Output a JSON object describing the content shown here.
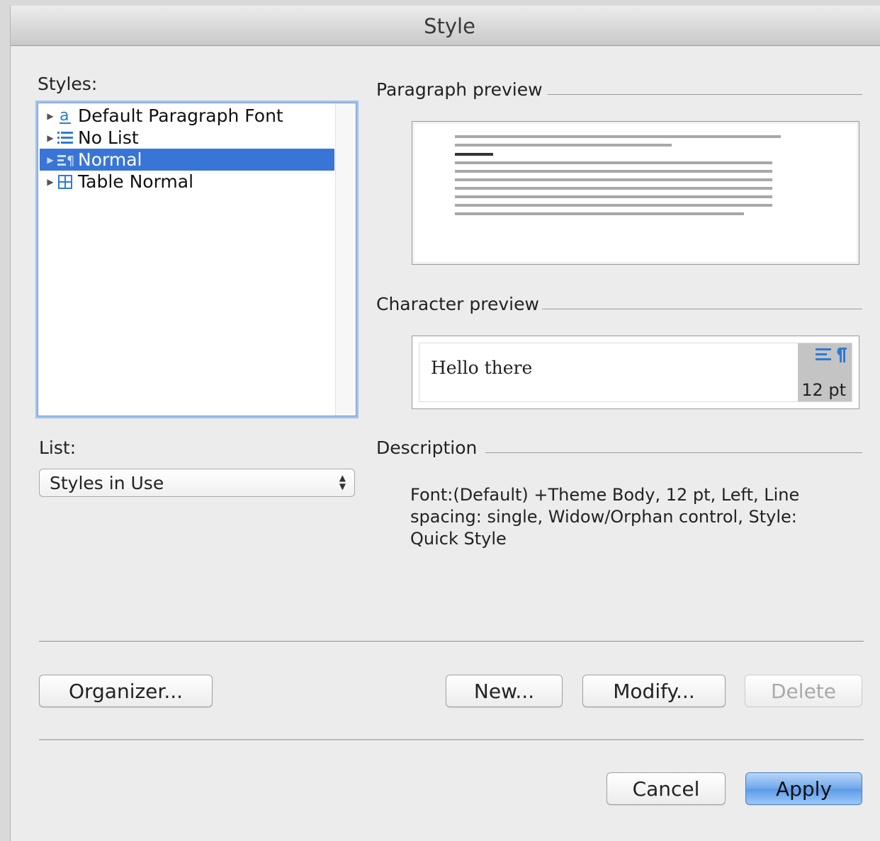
{
  "window": {
    "title": "Style"
  },
  "styles_panel": {
    "label": "Styles:",
    "items": [
      {
        "label": "Default Paragraph Font",
        "icon": "character-style-icon",
        "selected": false
      },
      {
        "label": "No List",
        "icon": "list-style-icon",
        "selected": false
      },
      {
        "label": "Normal",
        "icon": "paragraph-style-icon",
        "selected": true
      },
      {
        "label": "Table Normal",
        "icon": "table-style-icon",
        "selected": false
      }
    ]
  },
  "list_filter": {
    "label": "List:",
    "selected": "Styles in Use"
  },
  "paragraph_preview": {
    "title": "Paragraph preview"
  },
  "character_preview": {
    "title": "Character preview",
    "sample_text": "Hello there",
    "size": "12 pt"
  },
  "description": {
    "title": "Description",
    "text": "Font:(Default) +Theme Body, 12 pt, Left, Line spacing:  single, Widow/Orphan control, Style: Quick Style"
  },
  "buttons": {
    "organizer": "Organizer...",
    "new": "New...",
    "modify": "Modify...",
    "delete": "Delete",
    "cancel": "Cancel",
    "apply": "Apply"
  },
  "colors": {
    "selection": "#3875d7",
    "focus_ring": "#9fc2ee",
    "default_button": "#5b9ae8"
  }
}
